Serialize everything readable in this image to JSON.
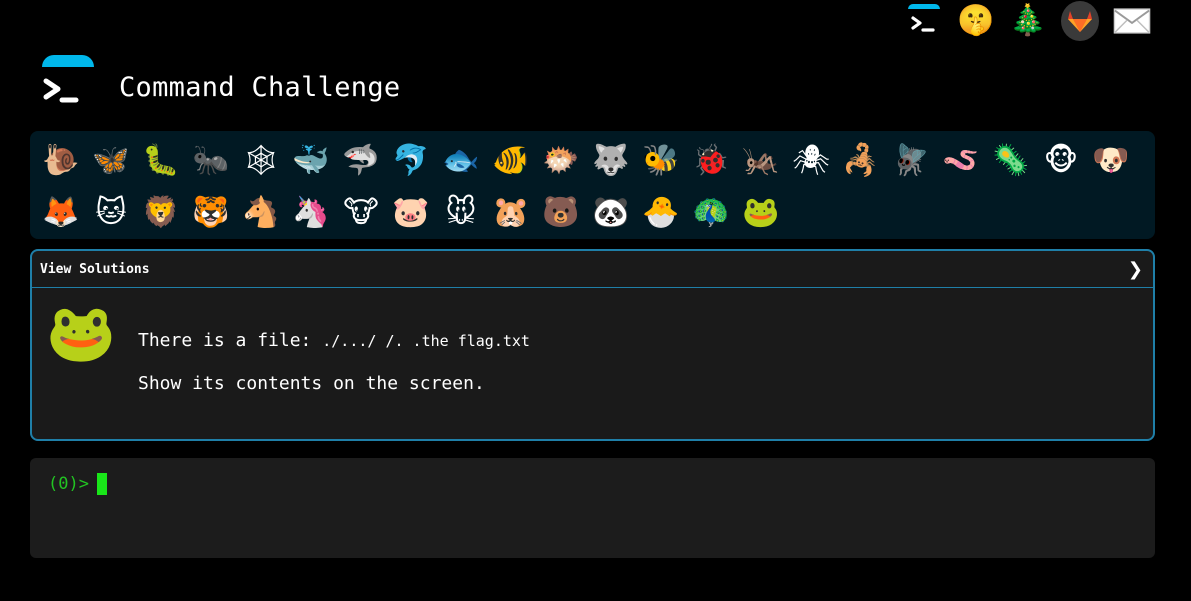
{
  "app": {
    "title": "Command Challenge"
  },
  "top_icons": [
    {
      "name": "terminal-icon"
    },
    {
      "name": "shushing-face-icon",
      "glyph": "🤫"
    },
    {
      "name": "christmas-tree-icon",
      "glyph": "🎄"
    },
    {
      "name": "gitlab-icon"
    },
    {
      "name": "envelope-icon",
      "glyph": "✉"
    }
  ],
  "animals": {
    "row1": [
      "🐌",
      "🦋",
      "🐛",
      "🐜",
      "🕸",
      "🐳",
      "🦈",
      "🐬",
      "🐟",
      "🐠",
      "🐡",
      "🐺",
      "🐝",
      "🐞",
      "🦗",
      "🕷",
      "🦂",
      "🪰",
      "🪱",
      "🦠",
      "🐵",
      "🐶"
    ],
    "row2": [
      "🦊",
      "🐱",
      "🦁",
      "🐯",
      "🐴",
      "🦄",
      "🐮",
      "🐷",
      "🐭",
      "🐹",
      "🐻",
      "🐼",
      "🐣",
      "🦚",
      "🐸"
    ]
  },
  "solutions": {
    "label": "View Solutions",
    "chevron": "❯"
  },
  "challenge": {
    "avatar": "🐸",
    "line1_prefix": "There is a file: ",
    "file_path": "./.../ /. .the flag.txt",
    "line2": "Show its contents on the screen."
  },
  "terminal": {
    "prompt": "(0)>",
    "input_value": ""
  },
  "colors": {
    "accent": "#00b7eb",
    "panel_border": "#1f7fa8",
    "animal_bar_bg": "#011923",
    "prompt_green": "#22c322",
    "cursor_green": "#19e619"
  }
}
